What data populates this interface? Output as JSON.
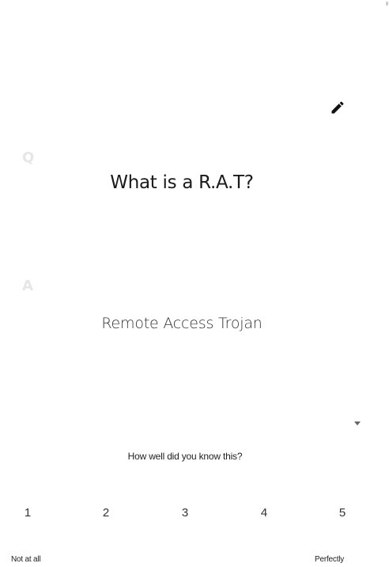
{
  "card": {
    "question_marker": "Q",
    "question": "What is a R.A.T?",
    "answer_marker": "A",
    "answer": "Remote Access Trojan",
    "edit_icon": "pencil-icon",
    "dropdown_icon": "caret-down-icon"
  },
  "rating": {
    "prompt": "How well did you know this?",
    "options": [
      "1",
      "2",
      "3",
      "4",
      "5"
    ],
    "low_label": "Not at all",
    "high_label": "Perfectly"
  }
}
